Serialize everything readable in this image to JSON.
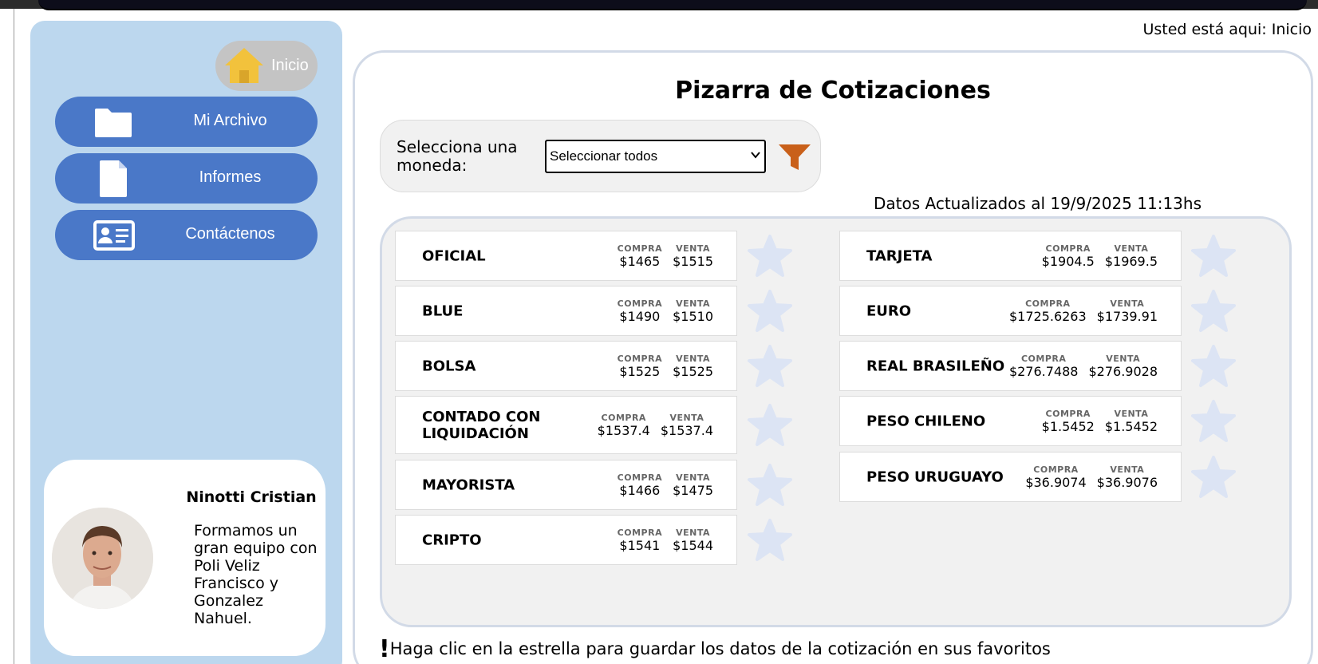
{
  "breadcrumb": "Usted está aqui: Inicio",
  "sidebar": {
    "home_label": "Inicio",
    "items": [
      {
        "label": "Mi Archivo",
        "icon": "folder-icon"
      },
      {
        "label": "Informes",
        "icon": "document-icon"
      },
      {
        "label": "Contáctenos",
        "icon": "contact-card-icon"
      }
    ],
    "profile": {
      "name": "Ninotti Cristian",
      "bio": "Formamos un gran equipo con Poli Veliz Francisco y Gonzalez Nahuel."
    }
  },
  "main": {
    "title": "Pizarra de Cotizaciones",
    "filter": {
      "label": "Selecciona una moneda:",
      "selected": "Seleccionar todos"
    },
    "updated": "Datos Actualizados al 19/9/2025 11:13hs",
    "buy_label": "COMPRA",
    "sell_label": "VENTA",
    "quotes_left": [
      {
        "name": "OFICIAL",
        "compra": "$1465",
        "venta": "$1515"
      },
      {
        "name": "BLUE",
        "compra": "$1490",
        "venta": "$1510"
      },
      {
        "name": "BOLSA",
        "compra": "$1525",
        "venta": "$1525"
      },
      {
        "name": "CONTADO CON LIQUIDACIÓN",
        "compra": "$1537.4",
        "venta": "$1537.4"
      },
      {
        "name": "MAYORISTA",
        "compra": "$1466",
        "venta": "$1475"
      },
      {
        "name": "CRIPTO",
        "compra": "$1541",
        "venta": "$1544"
      }
    ],
    "quotes_right": [
      {
        "name": "TARJETA",
        "compra": "$1904.5",
        "venta": "$1969.5"
      },
      {
        "name": "EURO",
        "compra": "$1725.6263",
        "venta": "$1739.91"
      },
      {
        "name": "REAL BRASILEÑO",
        "compra": "$276.7488",
        "venta": "$276.9028"
      },
      {
        "name": "PESO CHILENO",
        "compra": "$1.5452",
        "venta": "$1.5452"
      },
      {
        "name": "PESO URUGUAYO",
        "compra": "$36.9074",
        "venta": "$36.9076"
      }
    ],
    "hint_mark": "!",
    "hint": "Haga clic en la estrella para guardar los datos de la cotización en sus favoritos"
  },
  "colors": {
    "sidebar_bg": "#bcd7ee",
    "nav_button": "#4a78c8",
    "home_button": "#c4c4c4",
    "house_icon": "#f2c23c",
    "funnel_icon": "#c9601a",
    "star_icon": "#dce4f4"
  }
}
